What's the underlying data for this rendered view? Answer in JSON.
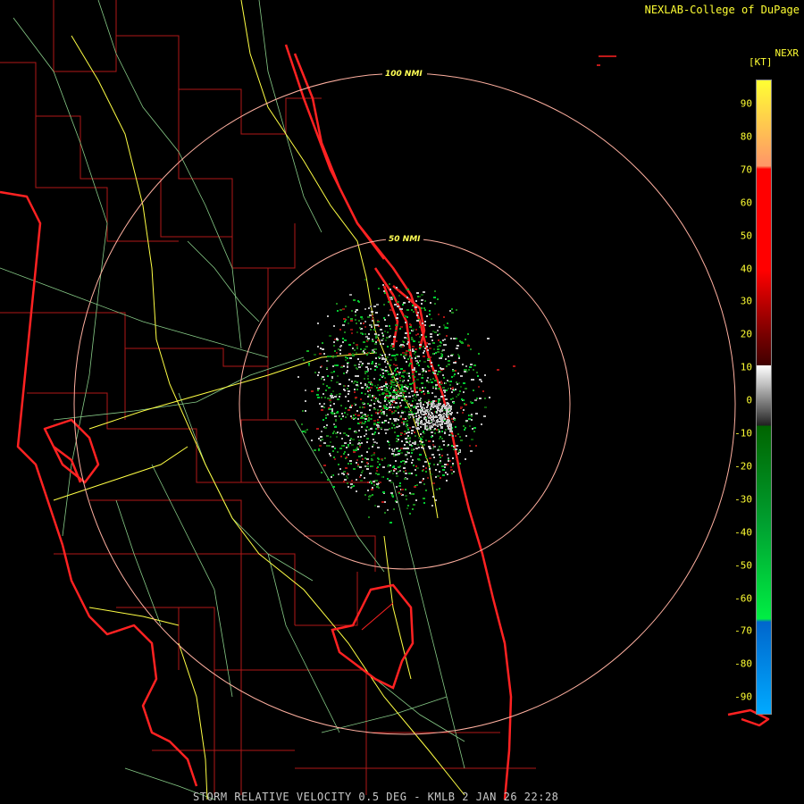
{
  "credit": "NEXLAB-College of DuPage",
  "product": "STORM RELATIVE VELOCITY 0.5 DEG - KMLB 2 JAN 26 22:28",
  "range_rings": [
    {
      "label": "100 NMI"
    },
    {
      "label": "50 NMI"
    }
  ],
  "legend": {
    "title": "NEXR",
    "unit": "[KT]",
    "ticks": [
      "90",
      "80",
      "70",
      "60",
      "50",
      "40",
      "30",
      "20",
      "10",
      "0",
      "-10",
      "-20",
      "-30",
      "-40",
      "-50",
      "-60",
      "-70",
      "-80",
      "-90"
    ],
    "colors": {
      "top": "#ffff33",
      "orange": "#ff9966",
      "red": "#ff0000",
      "dark_red": "#7a0000",
      "gray": "#c0c0c0",
      "dark_green": "#006400",
      "green": "#00ee44",
      "blue": "#0066cc",
      "light_blue": "#00aaff"
    }
  },
  "colors": {
    "coast": "#ff2222",
    "county": "#c01818",
    "roads": "#ffff44",
    "minor_roads": "#88cc88",
    "rings": "#ffb0a0"
  }
}
